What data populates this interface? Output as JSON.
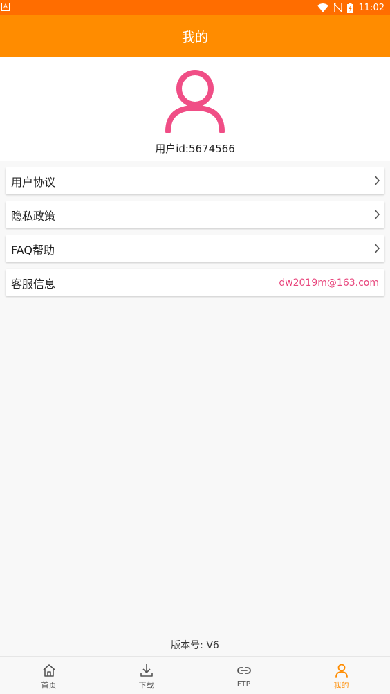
{
  "status_bar": {
    "left_badge": "A",
    "time": "11:02"
  },
  "app_bar": {
    "title": "我的"
  },
  "profile": {
    "user_id_text": "用户id:5674566"
  },
  "menu": [
    {
      "label": "用户协议"
    },
    {
      "label": "隐私政策"
    },
    {
      "label": "FAQ帮助"
    },
    {
      "label": "客服信息",
      "value": "dw2019m@163.com"
    }
  ],
  "version_text": "版本号: V6",
  "bottom_nav": [
    {
      "label": "首页",
      "icon": "home-icon"
    },
    {
      "label": "下载",
      "icon": "download-icon"
    },
    {
      "label": "FTP",
      "icon": "link-icon"
    },
    {
      "label": "我的",
      "icon": "person-icon",
      "active": true
    }
  ],
  "colors": {
    "status_bar": "#ff6d00",
    "app_bar": "#ff8c00",
    "avatar": "#f04e86",
    "email": "#e8457c",
    "nav_active": "#ff8c00"
  }
}
